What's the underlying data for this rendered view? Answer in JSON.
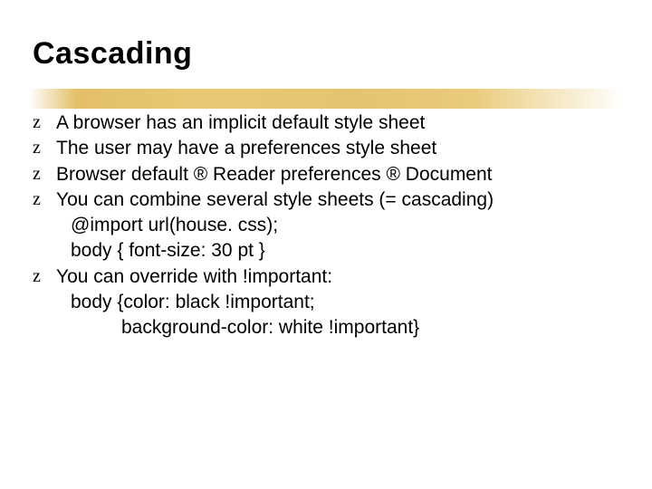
{
  "title": "Cascading",
  "bullet_glyph": "z",
  "arrow": "®",
  "bullets": [
    {
      "lines": [
        "A browser has an implicit default style sheet"
      ]
    },
    {
      "lines": [
        "The user may have a preferences style sheet"
      ]
    },
    {
      "lines": [
        "Browser default ® Reader preferences ® Document"
      ]
    },
    {
      "lines": [
        "You can combine several style sheets (= cascading)"
      ],
      "subs": [
        "@import url(house. css);",
        "body { font-size: 30 pt }"
      ]
    },
    {
      "lines": [
        "You can override with !important:"
      ],
      "subs": [
        "body {color: black !important;"
      ],
      "subs2": [
        "background-color: white !important}"
      ]
    }
  ]
}
